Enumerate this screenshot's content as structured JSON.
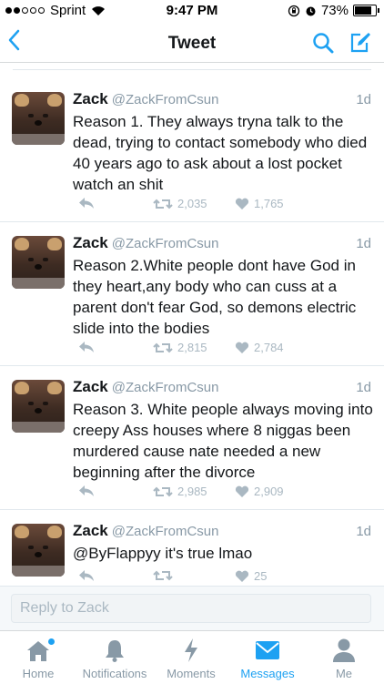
{
  "status_bar": {
    "carrier": "Sprint",
    "time": "9:47 PM",
    "battery": "73%"
  },
  "nav": {
    "title": "Tweet"
  },
  "tweets": [
    {
      "name": "Zack",
      "handle": "@ZackFromCsun",
      "age": "1d",
      "text": "Reason 1. They always tryna talk to the dead, trying to contact somebody who died 40 years ago to ask about a lost pocket watch an shit",
      "retweets": "2,035",
      "likes": "1,765"
    },
    {
      "name": "Zack",
      "handle": "@ZackFromCsun",
      "age": "1d",
      "text": "Reason 2.White people dont have God in they heart,any body who can cuss at a parent don't fear God, so demons electric slide into the bodies",
      "retweets": "2,815",
      "likes": "2,784"
    },
    {
      "name": "Zack",
      "handle": "@ZackFromCsun",
      "age": "1d",
      "text": "Reason 3. White people always moving into creepy Ass houses where 8 niggas been murdered cause nate needed a new beginning after the divorce",
      "retweets": "2,985",
      "likes": "2,909"
    },
    {
      "name": "Zack",
      "handle": "@ZackFromCsun",
      "age": "1d",
      "text": "@ByFlappyy it's true lmao",
      "retweets": "",
      "likes": "25"
    }
  ],
  "reply": {
    "placeholder": "Reply to Zack"
  },
  "tabs": [
    {
      "label": "Home",
      "icon": "home-icon"
    },
    {
      "label": "Notifications",
      "icon": "bell-icon"
    },
    {
      "label": "Moments",
      "icon": "lightning-icon"
    },
    {
      "label": "Messages",
      "icon": "envelope-icon"
    },
    {
      "label": "Me",
      "icon": "person-icon"
    }
  ],
  "colors": {
    "accent": "#1da1f2",
    "muted": "#8899a6",
    "action": "#aab8c2"
  }
}
